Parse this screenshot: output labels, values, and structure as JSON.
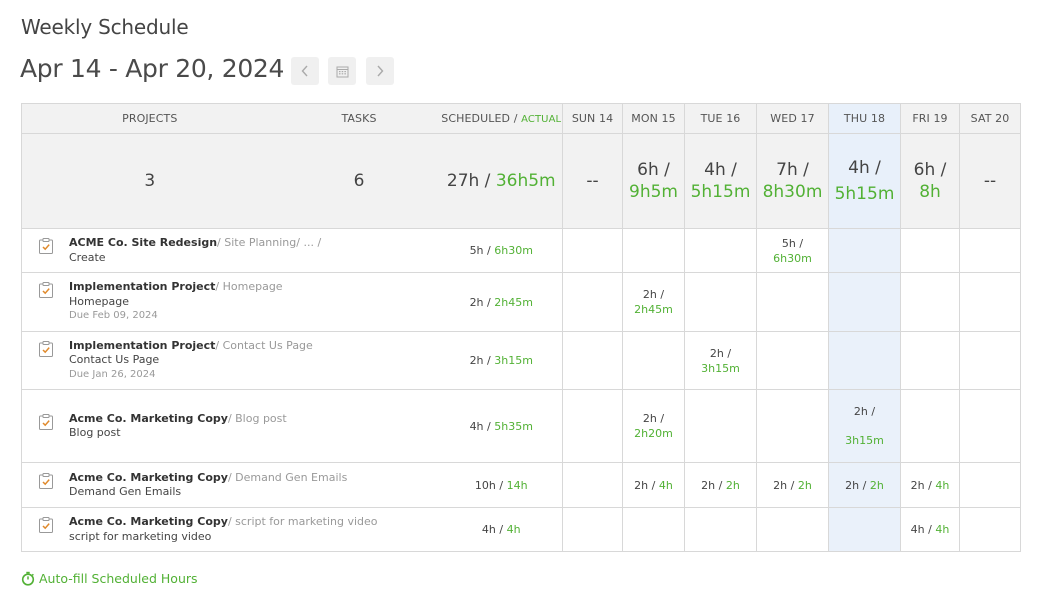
{
  "page": {
    "title": "Weekly Schedule",
    "date_range": "Apr 14 - Apr 20, 2024"
  },
  "nav": {
    "prev_icon": "chevron-left-icon",
    "calendar_icon": "calendar-icon",
    "next_icon": "chevron-right-icon"
  },
  "header": {
    "projects": "PROJECTS",
    "tasks": "TASKS",
    "scheduled": "SCHEDULED / ",
    "actual": "ACTUAL",
    "days": [
      "SUN 14",
      "MON 15",
      "TUE 16",
      "WED 17",
      "THU 18",
      "FRI 19",
      "SAT 20"
    ]
  },
  "totals": {
    "projects": "3",
    "tasks": "6",
    "scheduled": "27h / ",
    "actual": "36h5m",
    "days": [
      {
        "sched": "--",
        "actual": ""
      },
      {
        "sched": "6h /",
        "actual": "9h5m"
      },
      {
        "sched": "4h /",
        "actual": "5h15m"
      },
      {
        "sched": "7h /",
        "actual": "8h30m"
      },
      {
        "sched": "4h /",
        "actual": "5h15m"
      },
      {
        "sched": "6h /",
        "actual": "8h"
      },
      {
        "sched": "--",
        "actual": ""
      }
    ]
  },
  "rows": [
    {
      "project": "ACME Co. Site Redesign",
      "path": "/ Site Planning/ ... /",
      "task": "Create",
      "due": "",
      "sched": "5h / ",
      "actual": "6h30m",
      "days": [
        {
          "sched": "",
          "actual": ""
        },
        {
          "sched": "",
          "actual": ""
        },
        {
          "sched": "",
          "actual": ""
        },
        {
          "sched": "5h /",
          "actual": "6h30m"
        },
        {
          "sched": "",
          "actual": ""
        },
        {
          "sched": "",
          "actual": ""
        },
        {
          "sched": "",
          "actual": ""
        }
      ]
    },
    {
      "project": "Implementation Project",
      "path": "/ Homepage",
      "task": "Homepage",
      "due": "Due Feb 09, 2024",
      "sched": "2h / ",
      "actual": "2h45m",
      "days": [
        {
          "sched": "",
          "actual": ""
        },
        {
          "sched": "2h /",
          "actual": "2h45m"
        },
        {
          "sched": "",
          "actual": ""
        },
        {
          "sched": "",
          "actual": ""
        },
        {
          "sched": "",
          "actual": ""
        },
        {
          "sched": "",
          "actual": ""
        },
        {
          "sched": "",
          "actual": ""
        }
      ]
    },
    {
      "project": "Implementation Project",
      "path": "/ Contact Us Page",
      "task": "Contact Us Page",
      "due": "Due Jan 26, 2024",
      "sched": "2h / ",
      "actual": "3h15m",
      "days": [
        {
          "sched": "",
          "actual": ""
        },
        {
          "sched": "",
          "actual": ""
        },
        {
          "sched": "2h /",
          "actual": "3h15m"
        },
        {
          "sched": "",
          "actual": ""
        },
        {
          "sched": "",
          "actual": ""
        },
        {
          "sched": "",
          "actual": ""
        },
        {
          "sched": "",
          "actual": ""
        }
      ]
    },
    {
      "project": "Acme Co. Marketing Copy",
      "path": "/ Blog post",
      "task": "Blog post",
      "due": "",
      "sched": "4h / ",
      "actual": "5h35m",
      "days": [
        {
          "sched": "",
          "actual": ""
        },
        {
          "sched": "2h /",
          "actual": "2h20m"
        },
        {
          "sched": "",
          "actual": ""
        },
        {
          "sched": "",
          "actual": ""
        },
        {
          "sched": "2h /",
          "actual": "3h15m"
        },
        {
          "sched": "",
          "actual": ""
        },
        {
          "sched": "",
          "actual": ""
        }
      ]
    },
    {
      "project": "Acme Co. Marketing Copy",
      "path": "/ Demand Gen Emails",
      "task": "Demand Gen Emails",
      "due": "",
      "sched": "10h / ",
      "actual": "14h",
      "days": [
        {
          "sched": "",
          "actual": ""
        },
        {
          "sched": "2h / ",
          "actual": "4h"
        },
        {
          "sched": "2h / ",
          "actual": "2h"
        },
        {
          "sched": "2h / ",
          "actual": "2h"
        },
        {
          "sched": "2h / ",
          "actual": "2h"
        },
        {
          "sched": "2h / ",
          "actual": "4h"
        },
        {
          "sched": "",
          "actual": ""
        }
      ]
    },
    {
      "project": "Acme Co. Marketing Copy",
      "path": "/ script for marketing video",
      "task": "script for marketing video",
      "due": "",
      "sched": "4h / ",
      "actual": "4h",
      "days": [
        {
          "sched": "",
          "actual": ""
        },
        {
          "sched": "",
          "actual": ""
        },
        {
          "sched": "",
          "actual": ""
        },
        {
          "sched": "",
          "actual": ""
        },
        {
          "sched": "",
          "actual": ""
        },
        {
          "sched": "4h / ",
          "actual": "4h"
        },
        {
          "sched": "",
          "actual": ""
        }
      ]
    }
  ],
  "footer": {
    "autofill_label": "Auto-fill Scheduled Hours",
    "autofill_icon": "stopwatch-icon"
  },
  "colors": {
    "accent_green": "#52b135",
    "today_highlight": "#eaf1fa",
    "header_bg": "#f2f2f2"
  }
}
